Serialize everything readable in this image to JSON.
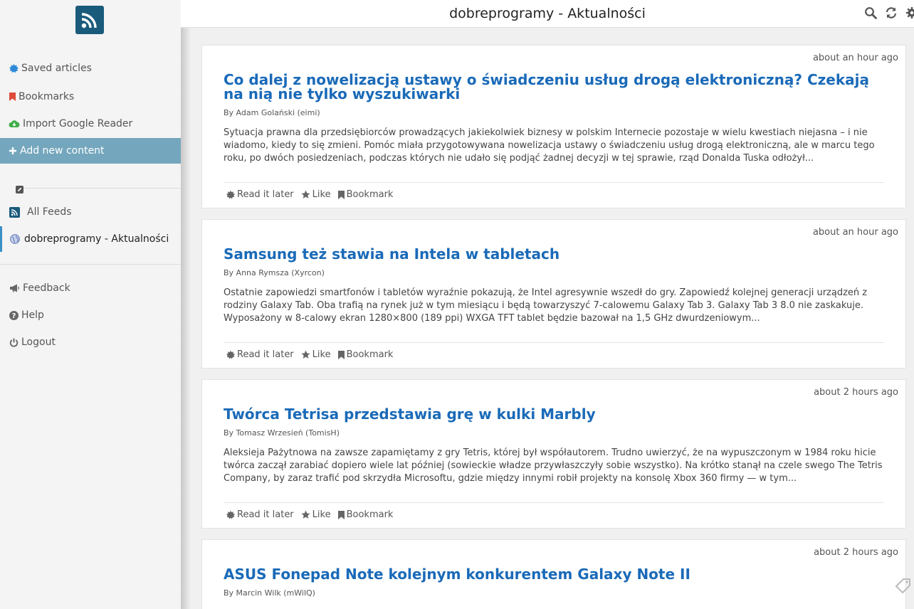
{
  "window": {
    "title": "dobreprogramy - Aktualności"
  },
  "colors": {
    "accent": "#1a6ab8",
    "active_nav": "#74a7bd",
    "logo_bg": "#1a5b7c"
  },
  "sidebar": {
    "saved_articles": "Saved articles",
    "bookmarks": "Bookmarks",
    "import_google_reader": "Import Google Reader",
    "add_new_content": "Add new content",
    "all_feeds": "All Feeds",
    "feed_dobreprogramy": "dobreprogramy - Aktualności",
    "feedback": "Feedback",
    "help": "Help",
    "logout": "Logout"
  },
  "article_actions": {
    "read_later": "Read it later",
    "like": "Like",
    "bookmark": "Bookmark"
  },
  "articles": [
    {
      "time": "about an hour ago",
      "title": "Co dalej z nowelizacją ustawy o świadczeniu usług drogą elektroniczną? Czekają na nią nie tylko wyszukiwarki",
      "author": "By Adam Golański (eimi)",
      "summary": "Sytuacja prawna dla przedsiębiorców prowadzących jakiekolwiek biznesy w polskim Internecie pozostaje w wielu kwestiach niejasna – i nie wiadomo, kiedy to się zmieni. Pomóc miała przygotowywana nowelizacja ustawy o świadczeniu usług drogą elektroniczną, ale w marcu tego roku, po dwóch posiedzeniach, podczas których nie udało się podjąć żadnej decyzji w tej sprawie, rząd Donalda Tuska odłożył..."
    },
    {
      "time": "about an hour ago",
      "title": "Samsung też stawia na Intela w tabletach",
      "author": "By Anna Rymsza (Xyrcon)",
      "summary": "Ostatnie zapowiedzi smartfonów i tabletów wyraźnie pokazują, że Intel agresywnie wszedł do gry. Zapowiedź kolejnej generacji urządzeń z rodziny Galaxy Tab. Oba trafią na rynek już w tym miesiącu i będą towarzyszyć 7-calowemu Galaxy Tab 3. Galaxy Tab 3 8.0 nie zaskakuje. Wyposażony w 8-calowy ekran 1280×800 (189 ppi) WXGA TFT tablet będzie bazował na 1,5 GHz dwurdzeniowym..."
    },
    {
      "time": "about 2 hours ago",
      "title": "Twórca Tetrisa przedstawia grę w kulki Marbly",
      "author": "By Tomasz Wrzesień (TomisH)",
      "summary": "Aleksieja Pażytnowa na zawsze zapamiętamy z gry Tetris, której był współautorem. Trudno uwierzyć, że na wypuszczonym w 1984 roku hicie twórca zaczął zarabiać dopiero wiele lat później (sowieckie władze przywłaszczyły sobie wszystko). Na krótko stanął na czele swego The Tetris Company, by zaraz trafić pod skrzydła Microsoftu, gdzie między innymi robił projekty na konsolę Xbox 360 firmy — w tym..."
    },
    {
      "time": "about 2 hours ago",
      "title": "ASUS Fonepad Note kolejnym konkurentem Galaxy Note II",
      "author": "By Marcin Wilk (mWilQ)",
      "summary": ""
    }
  ]
}
